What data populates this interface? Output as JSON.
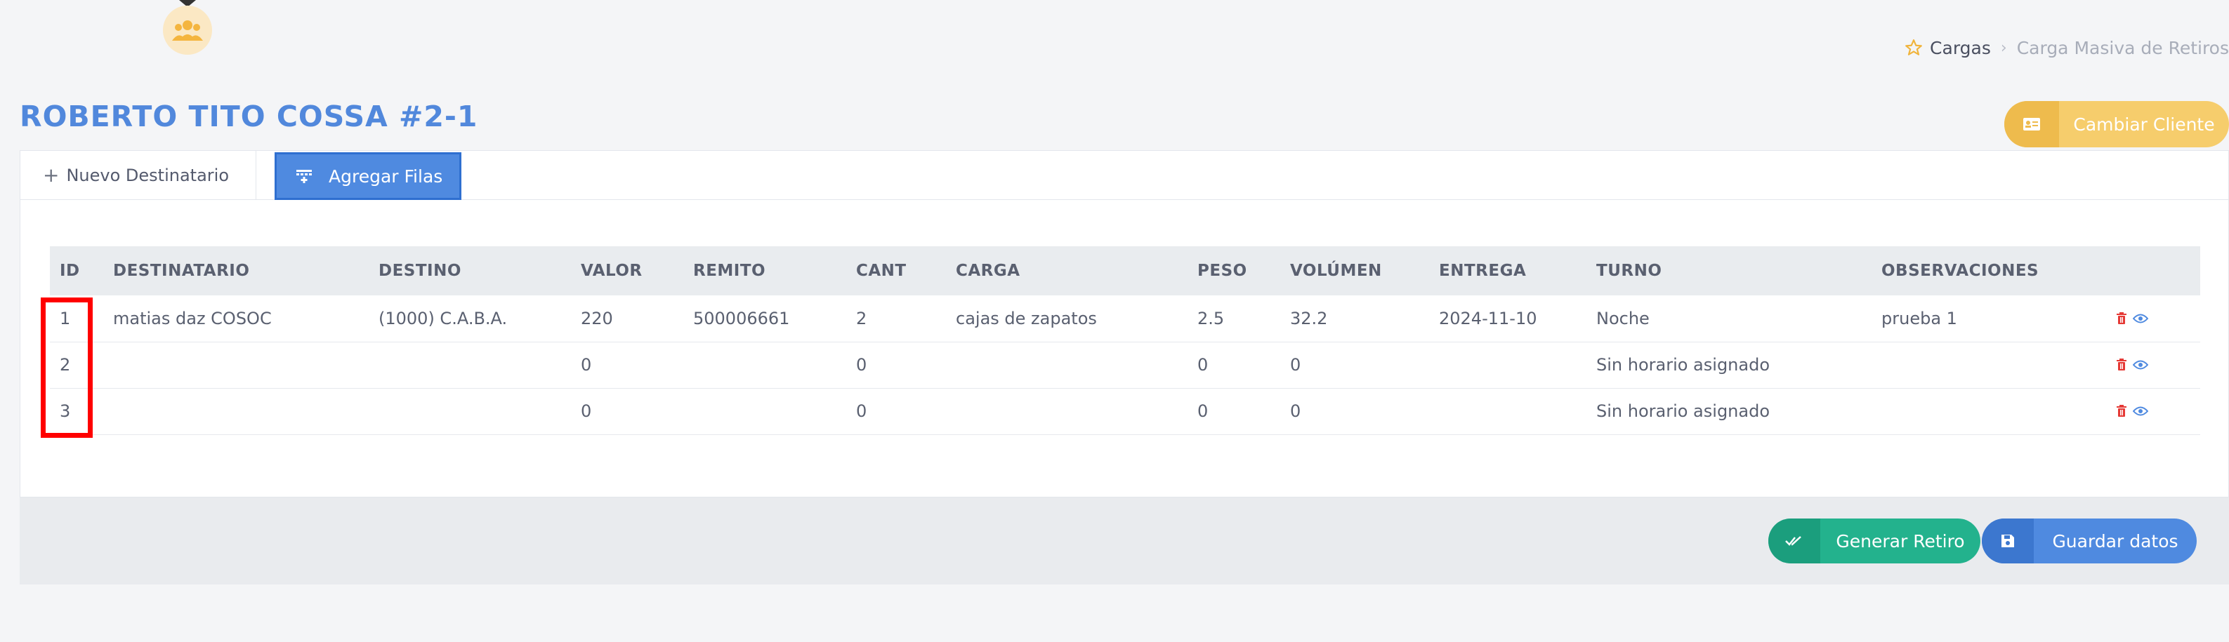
{
  "header": {
    "breadcrumb": {
      "home": "Cargas",
      "current": "Carga Masiva de Retiros"
    },
    "title": "ROBERTO TITO COSSA #2-1",
    "change_client_label": "Cambiar Cliente"
  },
  "tabs": {
    "new_recipient": "Nuevo Destinatario",
    "add_rows": "Agregar Filas"
  },
  "table": {
    "columns": [
      "ID",
      "DESTINATARIO",
      "DESTINO",
      "VALOR",
      "REMITO",
      "CANT",
      "CARGA",
      "PESO",
      "VOLÚMEN",
      "ENTREGA",
      "TURNO",
      "OBSERVACIONES",
      ""
    ],
    "rows": [
      [
        "1",
        "matias daz COSOC",
        "(1000) C.A.B.A.",
        "220",
        "500006661",
        "2",
        "cajas de zapatos",
        "2.5",
        "32.2",
        "2024-11-10",
        "Noche",
        "prueba 1"
      ],
      [
        "2",
        "",
        "",
        "0",
        "",
        "0",
        "",
        "0",
        "0",
        "",
        "Sin horario asignado",
        ""
      ],
      [
        "3",
        "",
        "",
        "0",
        "",
        "0",
        "",
        "0",
        "0",
        "",
        "Sin horario asignado",
        ""
      ]
    ]
  },
  "footer": {
    "generate_label": "Generar Retiro",
    "save_label": "Guardar datos"
  },
  "icons": {
    "avatar": "users-group-icon",
    "breadcrumb_home": "star-icon",
    "change_client": "id-card-icon",
    "add_rows": "table-rows-icon",
    "delete": "trash-icon",
    "view": "eye-icon",
    "generate": "double-check-icon",
    "save": "floppy-disk-icon"
  },
  "colors": {
    "accent": "#4f8ae0",
    "title": "#5188dc",
    "warning": "#f6cd6c",
    "success": "#23b28d",
    "danger": "#e53935",
    "highlight": "#ff0000"
  }
}
